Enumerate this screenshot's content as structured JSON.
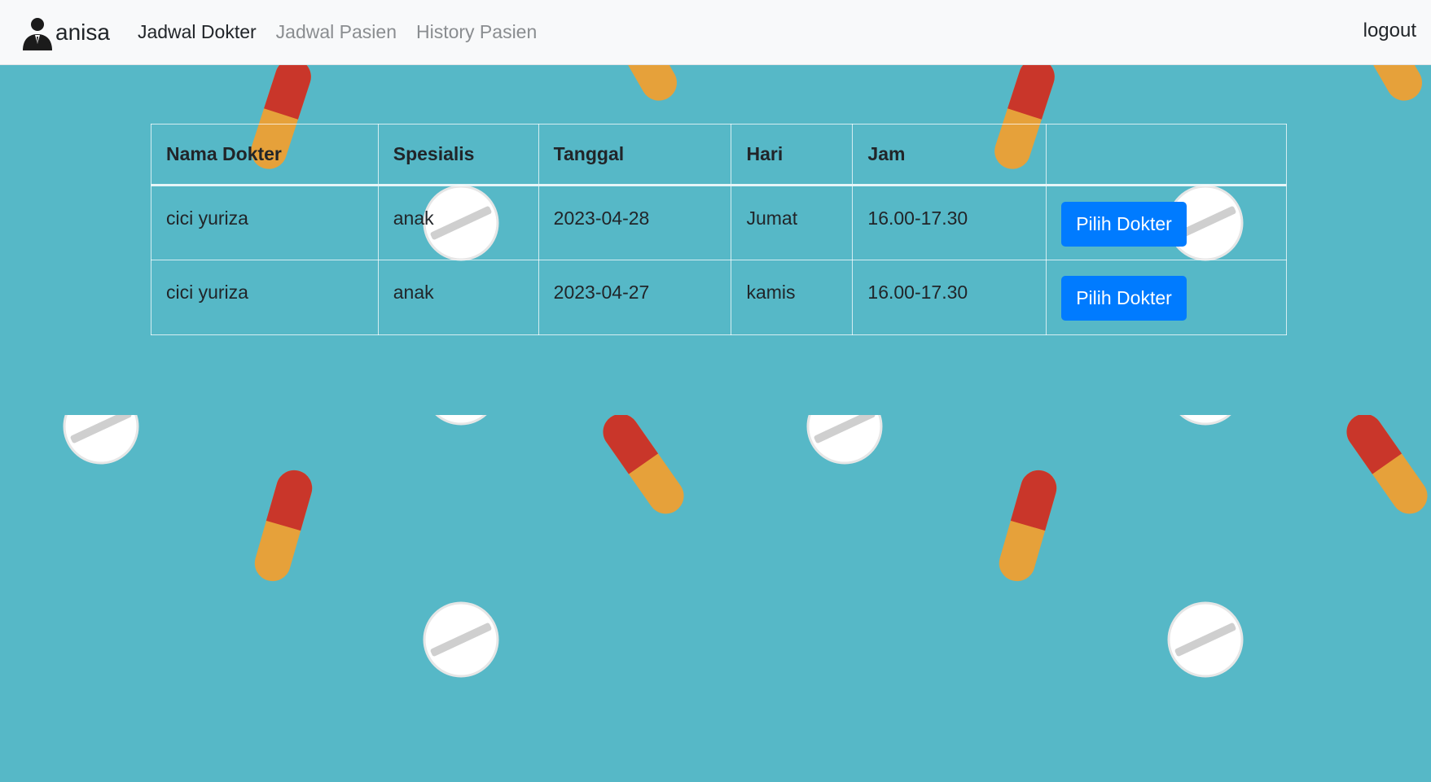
{
  "navbar": {
    "user_name": "anisa",
    "links": [
      {
        "label": "Jadwal Dokter",
        "active": true
      },
      {
        "label": "Jadwal Pasien",
        "active": false
      },
      {
        "label": "History Pasien",
        "active": false
      }
    ],
    "logout_label": "logout"
  },
  "table": {
    "headers": [
      "Nama Dokter",
      "Spesialis",
      "Tanggal",
      "Hari",
      "Jam",
      ""
    ],
    "rows": [
      {
        "nama": "cici yuriza",
        "spesialis": "anak",
        "tanggal": "2023-04-28",
        "hari": "Jumat",
        "jam": "16.00-17.30",
        "button": "Pilih Dokter"
      },
      {
        "nama": "cici yuriza",
        "spesialis": "anak",
        "tanggal": "2023-04-27",
        "hari": "kamis",
        "jam": "16.00-17.30",
        "button": "Pilih Dokter"
      }
    ]
  },
  "colors": {
    "background": "#56b8c7",
    "navbar": "#f8f9fa",
    "button": "#007bff",
    "capsule_red": "#c9362a",
    "capsule_orange": "#e6a13a",
    "tablet": "#ffffff"
  },
  "icons": {
    "avatar": "user-suit-icon",
    "background_pattern": "pills-pattern"
  }
}
